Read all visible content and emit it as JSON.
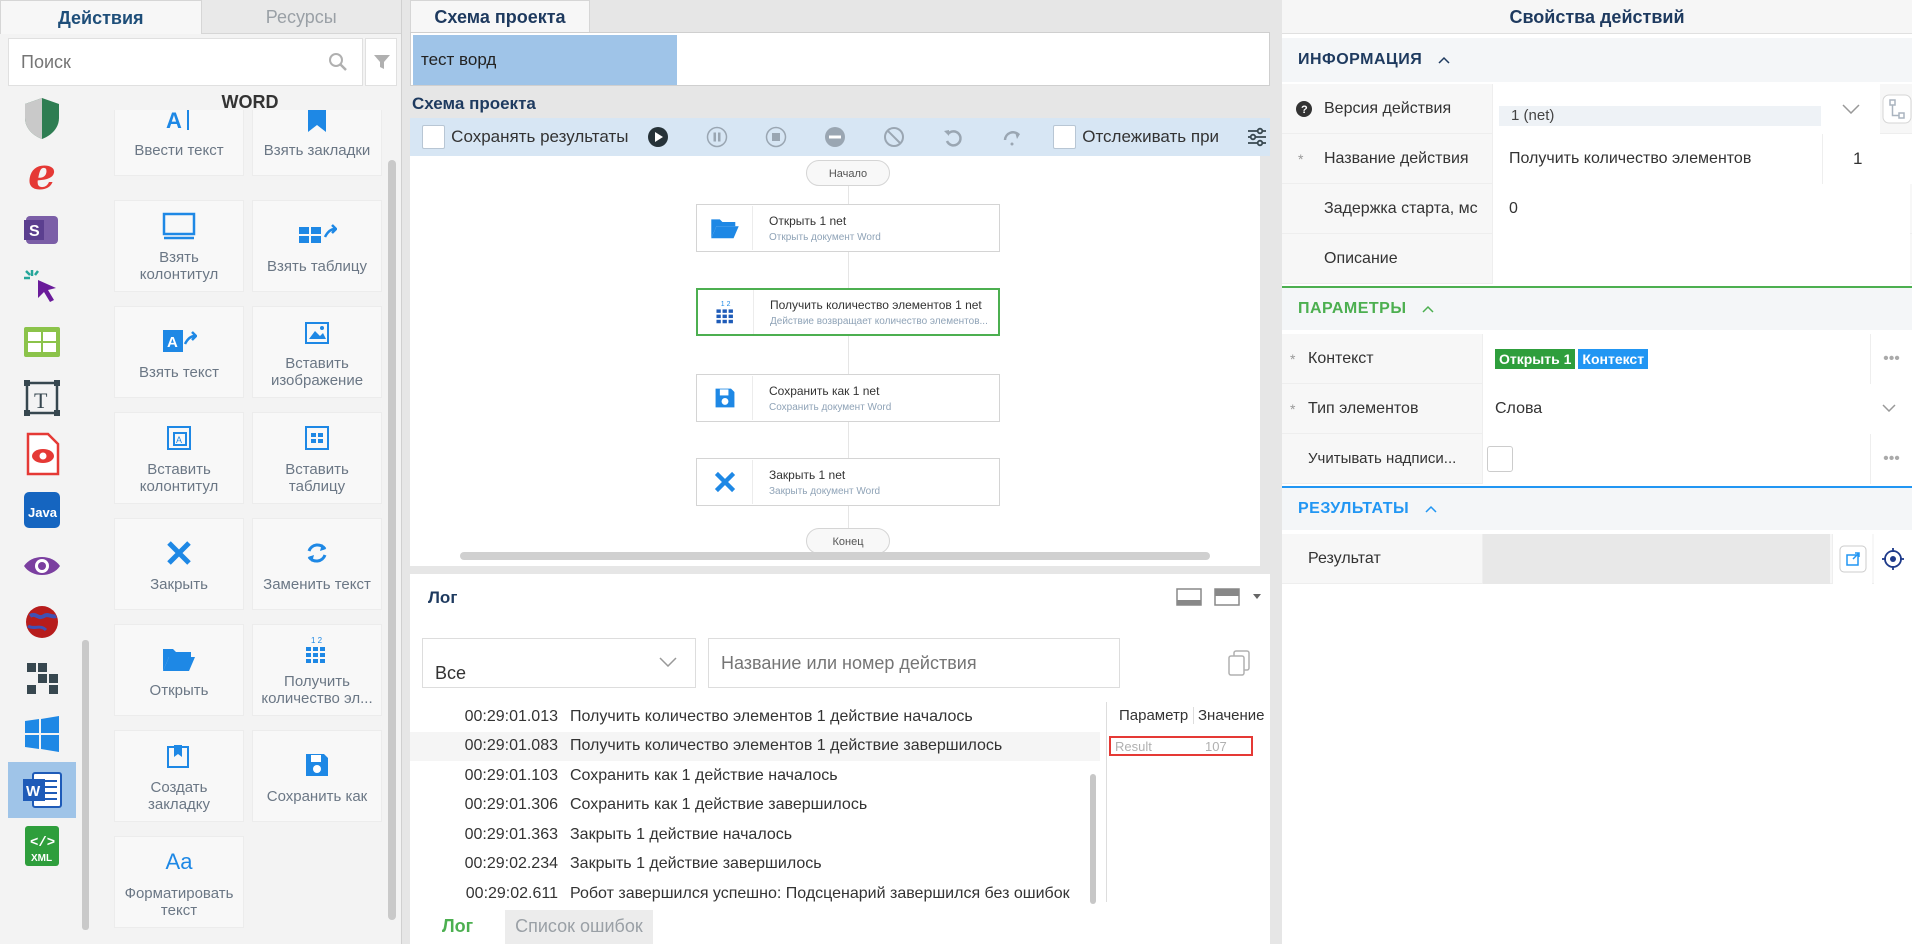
{
  "left": {
    "tabs": [
      "Действия",
      "Ресурсы"
    ],
    "search_placeholder": "Поиск",
    "category": "WORD",
    "actions": [
      {
        "label": "Ввести текст",
        "icon": "text-input-icon"
      },
      {
        "label": "Взять закладки",
        "icon": "bookmark-icon"
      },
      {
        "label": "Взять колонтитул",
        "icon": "header-footer-icon"
      },
      {
        "label": "Взять таблицу",
        "icon": "table-get-icon"
      },
      {
        "label": "Взять текст",
        "icon": "text-get-icon"
      },
      {
        "label": "Вставить изображение",
        "icon": "image-insert-icon"
      },
      {
        "label": "Вставить колонтитул",
        "icon": "header-insert-icon"
      },
      {
        "label": "Вставить таблицу",
        "icon": "table-insert-icon"
      },
      {
        "label": "Закрыть",
        "icon": "close-icon"
      },
      {
        "label": "Заменить текст",
        "icon": "replace-icon"
      },
      {
        "label": "Открыть",
        "icon": "folder-open-icon"
      },
      {
        "label": "Получить количество эл...",
        "icon": "count-grid-icon"
      },
      {
        "label": "Создать закладку",
        "icon": "bookmark-create-icon"
      },
      {
        "label": "Сохранить как",
        "icon": "save-icon"
      },
      {
        "label": "Форматировать текст",
        "icon": "format-text-icon"
      }
    ]
  },
  "center": {
    "tab": "Схема проекта",
    "document": "тест ворд",
    "schema_title": "Схема проекта",
    "toolbar": {
      "save_results": "Сохранять результаты",
      "track": "Отслеживать при"
    },
    "flow": {
      "start": "Начало",
      "end": "Конец",
      "nodes": [
        {
          "title": "Открыть  1  net",
          "sub": "Открыть документ Word"
        },
        {
          "title": "Получить количество элементов  1  net",
          "sub": "Действие возвращает количество элементов..."
        },
        {
          "title": "Сохранить как  1  net",
          "sub": "Сохранить документ Word"
        },
        {
          "title": "Закрыть  1  net",
          "sub": "Закрыть документ Word"
        }
      ]
    },
    "log": {
      "title": "Лог",
      "filter": "Все",
      "search_placeholder": "Название или номер действия",
      "rows": [
        {
          "time": "00:29:01.013",
          "text": "Получить количество элементов 1 действие началось"
        },
        {
          "time": "00:29:01.083",
          "text": "Получить количество элементов 1 действие завершилось"
        },
        {
          "time": "00:29:01.103",
          "text": "Сохранить как 1 действие началось"
        },
        {
          "time": "00:29:01.306",
          "text": "Сохранить как 1 действие завершилось"
        },
        {
          "time": "00:29:01.363",
          "text": "Закрыть 1 действие началось"
        },
        {
          "time": "00:29:02.234",
          "text": "Закрыть 1 действие завершилось"
        },
        {
          "time": "00:29:02.611",
          "text": "Робот завершился успешно: Подсценарий завершился без ошибок"
        }
      ],
      "param_header": "Параметр",
      "value_header": "Значение",
      "param_name": "Result",
      "param_value": "107",
      "bottom_tabs": [
        "Лог",
        "Список ошибок"
      ]
    }
  },
  "right": {
    "title": "Свойства действий",
    "sections": {
      "info": "ИНФОРМАЦИЯ",
      "params": "ПАРАМЕТРЫ",
      "results": "РЕЗУЛЬТАТЫ"
    },
    "info": {
      "version_label": "Версия действия",
      "version_value": "1 (net)",
      "name_label": "Название действия",
      "name_value": "Получить количество элементов",
      "name_num": "1",
      "delay_label": "Задержка старта, мс",
      "delay_value": "0",
      "desc_label": "Описание"
    },
    "params": {
      "context_label": "Контекст",
      "context_tag1": "Открыть 1",
      "context_tag2": "Контекст",
      "type_label": "Тип элементов",
      "type_value": "Слова",
      "inscriptions_label": "Учитывать надписи..."
    },
    "results": {
      "result_label": "Результат"
    },
    "colors": {
      "info": "#1e3a5f",
      "params": "#4caf50",
      "results": "#2196f3"
    }
  }
}
